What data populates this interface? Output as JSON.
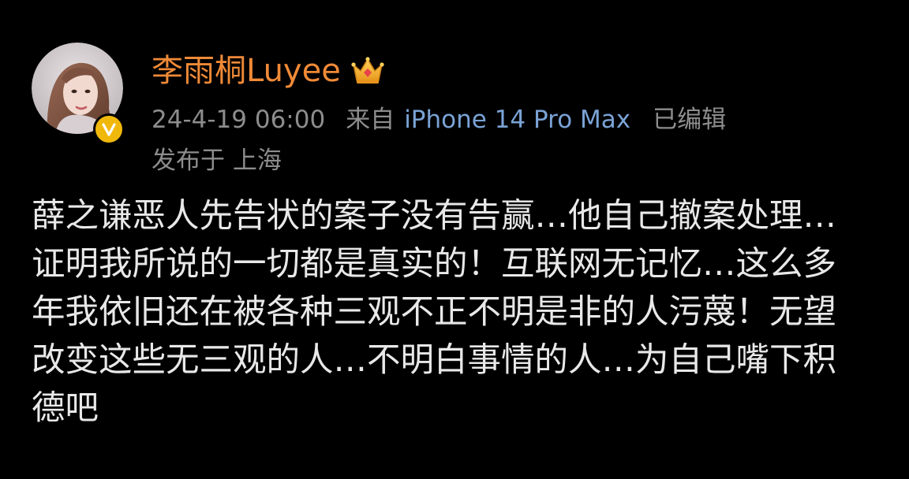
{
  "post": {
    "username": "李雨桐Luyee",
    "badge_icon": "crown-icon",
    "verified_icon": "verified-icon",
    "timestamp": "24-4-19 06:00",
    "source_prefix": "来自",
    "device": "iPhone 14 Pro Max",
    "edited_label": "已编辑",
    "location": "发布于 上海",
    "content_lines": [
      "薛之谦恶人先告状的案子没有告赢…他自己撤案处理…",
      "证明我所说的一切都是真实的！互联网无记忆…这么多",
      "年我依旧还在被各种三观不正不明是非的人污蔑！无望",
      "改变这些无三观的人…不明白事情的人…为自己嘴下积",
      "德吧"
    ]
  },
  "colors": {
    "background": "#000000",
    "username": "#f08a37",
    "meta": "#8d8d8d",
    "device_link": "#7aa3d6",
    "body_text": "#e8e8e8",
    "verified_badge": "#f1b80c"
  }
}
